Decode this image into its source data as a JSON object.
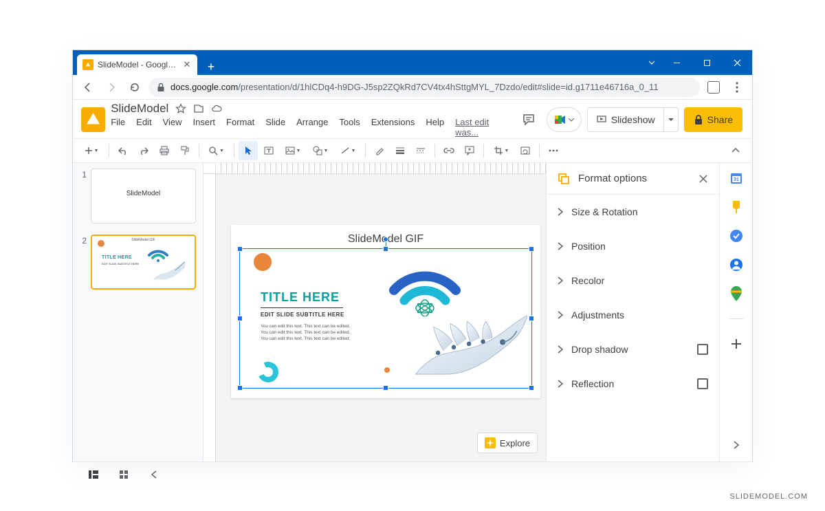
{
  "browser": {
    "tab_title": "SlideModel - Google Slides",
    "url_host": "docs.google.com",
    "url_path": "/presentation/d/1hlCDq4-h9DG-J5sp2ZQkRd7CV4tx4hSttgMYL_7Dzdo/edit#slide=id.g1711e46716a_0_11"
  },
  "header": {
    "doc_title": "SlideModel",
    "slideshow_label": "Slideshow",
    "share_label": "Share",
    "last_edit": "Last edit was..."
  },
  "menus": [
    "File",
    "Edit",
    "View",
    "Insert",
    "Format",
    "Slide",
    "Arrange",
    "Tools",
    "Extensions",
    "Help"
  ],
  "thumbnails": [
    {
      "num": "1",
      "label": "SlideModel"
    },
    {
      "num": "2",
      "label": "SlideModel GIF"
    }
  ],
  "slide": {
    "header": "SlideModel GIF",
    "title": "TITLE HERE",
    "subtitle": "EDIT SLIDE SUBTITLE HERE",
    "body": "You can edit this text. This text can be edited. You can edit this text. This text can be edited. You can edit this text. This text can be edited."
  },
  "explore": {
    "label": "Explore"
  },
  "format_pane": {
    "title": "Format options",
    "sections": [
      {
        "label": "Size & Rotation",
        "checkbox": false
      },
      {
        "label": "Position",
        "checkbox": false
      },
      {
        "label": "Recolor",
        "checkbox": false
      },
      {
        "label": "Adjustments",
        "checkbox": false
      },
      {
        "label": "Drop shadow",
        "checkbox": true
      },
      {
        "label": "Reflection",
        "checkbox": true
      }
    ]
  },
  "watermark": "SLIDEMODEL.COM"
}
